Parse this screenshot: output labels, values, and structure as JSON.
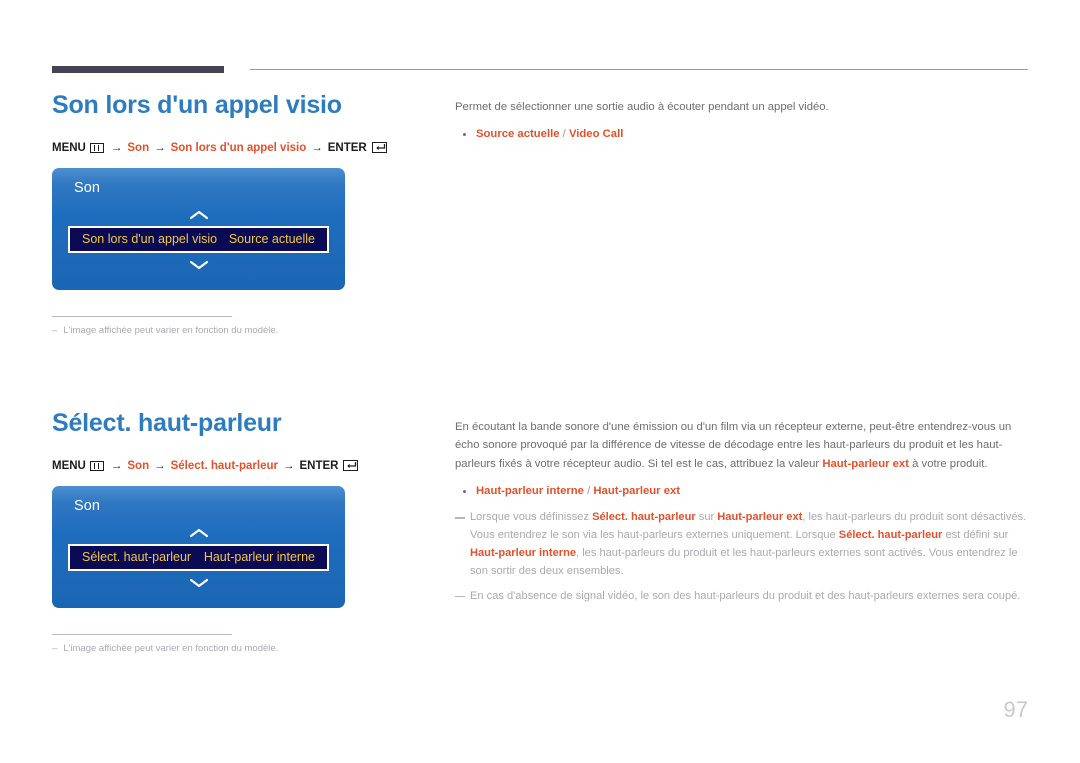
{
  "page": {
    "number": "97",
    "accent_blue": "#2e7cc0",
    "accent_orange": "#e3502b",
    "osd_highlight_bg": "#0a0a55",
    "osd_highlight_text": "#f2c940",
    "rule_dark": "#454254"
  },
  "sections": [
    {
      "heading": "Son lors d'un appel visio",
      "menu_path": {
        "menu_label": "MENU",
        "menu_icon": "menu-bars-icon",
        "arrow": "→",
        "step1": "Son",
        "step2": "Son lors d'un appel visio",
        "enter_label": "ENTER",
        "enter_icon": "enter-return-icon"
      },
      "osd": {
        "title": "Son",
        "up_icon": "chevron-up-icon",
        "down_icon": "chevron-down-icon",
        "row_label": "Son lors d'un appel visio",
        "row_value": "Source actuelle"
      },
      "footnote": {
        "dash": "–",
        "text": "L'image affichée peut varier en fonction du modèle."
      },
      "description": "Permet de sélectionner une sortie audio à écouter pendant un appel vidéo.",
      "options": [
        {
          "bold_parts": [
            "Source actuelle",
            "Video Call"
          ],
          "separator": " / "
        }
      ],
      "notes": []
    },
    {
      "heading": "Sélect. haut-parleur",
      "menu_path": {
        "menu_label": "MENU",
        "menu_icon": "menu-bars-icon",
        "arrow": "→",
        "step1": "Son",
        "step2": "Sélect. haut-parleur",
        "enter_label": "ENTER",
        "enter_icon": "enter-return-icon"
      },
      "osd": {
        "title": "Son",
        "up_icon": "chevron-up-icon",
        "down_icon": "chevron-down-icon",
        "row_label": "Sélect. haut-parleur",
        "row_value": "Haut-parleur interne"
      },
      "footnote": {
        "dash": "–",
        "text": "L'image affichée peut varier en fonction du modèle."
      },
      "description_html": "En écoutant la bande sonore d'une émission ou d'un film via un récepteur externe, peut-être entendrez-vous un écho sonore provoqué par la différence de vitesse de décodage entre les haut-parleurs du produit et les haut-parleurs fixés à votre récepteur audio. Si tel est le cas, attribuez la valeur <b>Haut-parleur ext</b> à votre produit.",
      "options": [
        {
          "bold_parts": [
            "Haut-parleur interne",
            "Haut-parleur ext"
          ],
          "separator": " / "
        }
      ],
      "notes": [
        "Lorsque vous définissez <b>Sélect. haut-parleur</b> sur <b>Haut-parleur ext</b>, les haut-parleurs du produit sont désactivés. Vous entendrez le son via les haut-parleurs externes uniquement. Lorsque <b>Sélect. haut-parleur</b> est défini sur <b>Haut-parleur interne</b>, les haut-parleurs du produit et les haut-parleurs externes sont activés. Vous entendrez le son sortir des deux ensembles.",
        "En cas d'absence de signal vidéo, le son des haut-parleurs du produit et des haut-parleurs externes sera coupé."
      ]
    }
  ]
}
